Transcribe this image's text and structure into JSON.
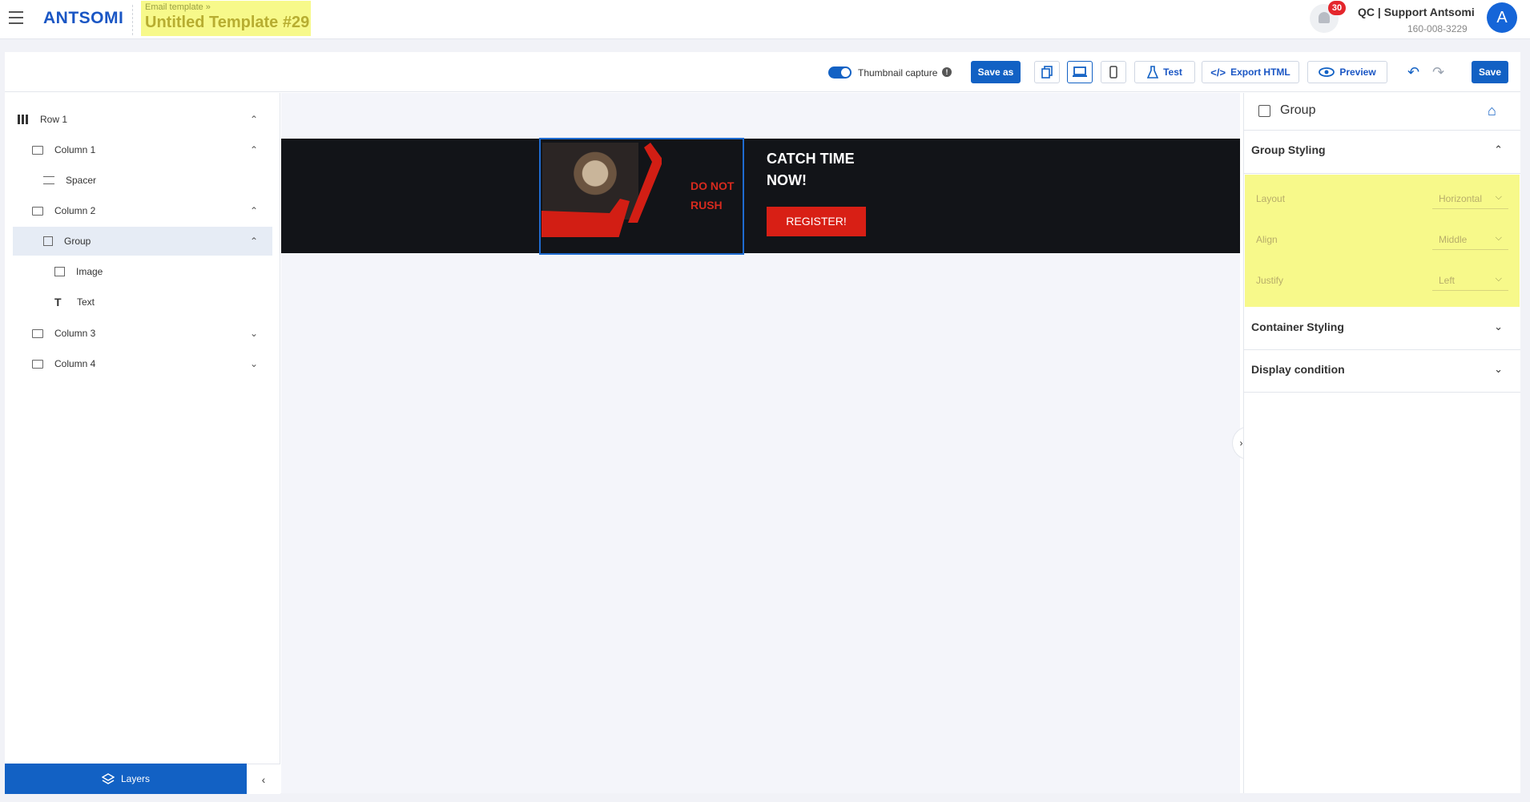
{
  "header": {
    "logo": "ANTSOMI",
    "breadcrumb": "Email template »",
    "title": "Untitled Template #29",
    "notifications_count": "30",
    "user_name": "QC | Support Antsomi",
    "user_id": "160-008-3229",
    "avatar_letter": "A"
  },
  "toolbar": {
    "thumbnail_label": "Thumbnail capture",
    "thumbnail_enabled": true,
    "save_as": "Save as",
    "test": "Test",
    "export_html": "Export HTML",
    "preview": "Preview",
    "save": "Save"
  },
  "layers": {
    "items": [
      {
        "label": "Row 1"
      },
      {
        "label": "Column 1"
      },
      {
        "label": "Spacer"
      },
      {
        "label": "Column 2"
      },
      {
        "label": "Group"
      },
      {
        "label": "Image"
      },
      {
        "label": "Text"
      },
      {
        "label": "Column 3"
      },
      {
        "label": "Column 4"
      }
    ],
    "footer_label": "Layers"
  },
  "canvas": {
    "image_text_line1": "DO NOT",
    "image_text_line2": "RUSH",
    "headline_line1": "CATCH TIME",
    "headline_line2": "NOW!",
    "button_label": "REGISTER!"
  },
  "right_panel": {
    "title": "Group",
    "group_styling": "Group Styling",
    "layout_label": "Layout",
    "layout_value": "Horizontal",
    "align_label": "Align",
    "align_value": "Middle",
    "justify_label": "Justify",
    "justify_value": "Left",
    "container_styling": "Container Styling",
    "display_condition": "Display condition"
  },
  "colors": {
    "accent": "#1261c4",
    "highlight": "#f7f98a",
    "banner_bg": "#121418",
    "cta_red": "#d81f15"
  }
}
